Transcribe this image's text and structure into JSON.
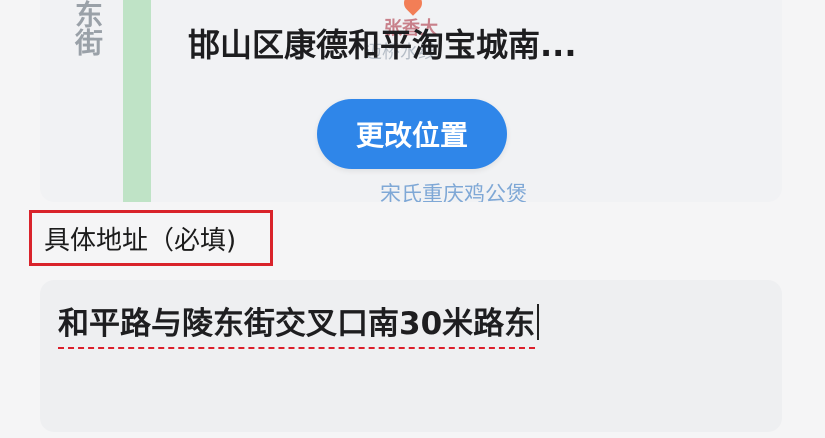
{
  "map": {
    "road_label": "东街",
    "poi_name": "张香大",
    "poi_sub": "迈桥水线",
    "place_text": "邯山区康德和平淘宝城南...",
    "change_location_label": "更改位置",
    "poi_bottom": "宋氏重庆鸡公煲"
  },
  "address": {
    "label": "具体地址（必填)",
    "value": "和平路与陵东街交叉口南30米路东"
  },
  "colors": {
    "accent": "#2f86e9",
    "highlight_border": "#d9232b"
  }
}
